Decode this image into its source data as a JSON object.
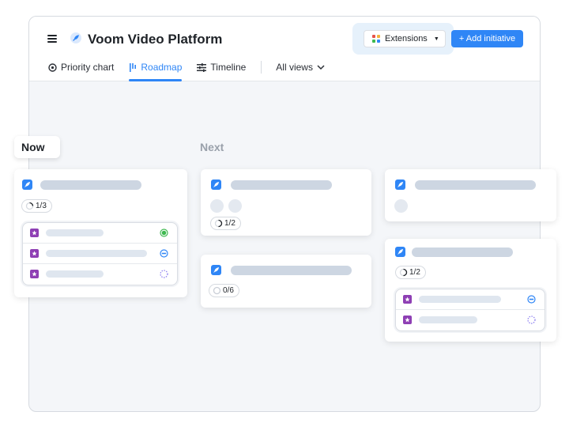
{
  "header": {
    "app_title": "Voom Video Platform",
    "extensions_label": "Extensions",
    "add_initiative_label": "+ Add initiative"
  },
  "tabs": [
    {
      "label": "Priority chart",
      "icon": "target-icon",
      "active": false
    },
    {
      "label": "Roadmap",
      "icon": "roadmap-icon",
      "active": true
    },
    {
      "label": "Timeline",
      "icon": "timeline-icon",
      "active": false
    }
  ],
  "views_dropdown": {
    "label": "All views"
  },
  "columns": {
    "now": "Now",
    "next": "Next"
  },
  "cards": {
    "now_1": {
      "progress": "1/3"
    },
    "next_1": {
      "progress": "1/2"
    },
    "next_2": {
      "progress": "0/6"
    },
    "later_2": {
      "progress": "1/2"
    }
  },
  "colors": {
    "accent": "#2f86f6",
    "placeholder_bar": "#cdd6e2",
    "epic_purple": "#8e3fb4",
    "status_green": "#3fb950",
    "status_blue": "#2f86f6",
    "status_violet": "#8a7cf0"
  }
}
